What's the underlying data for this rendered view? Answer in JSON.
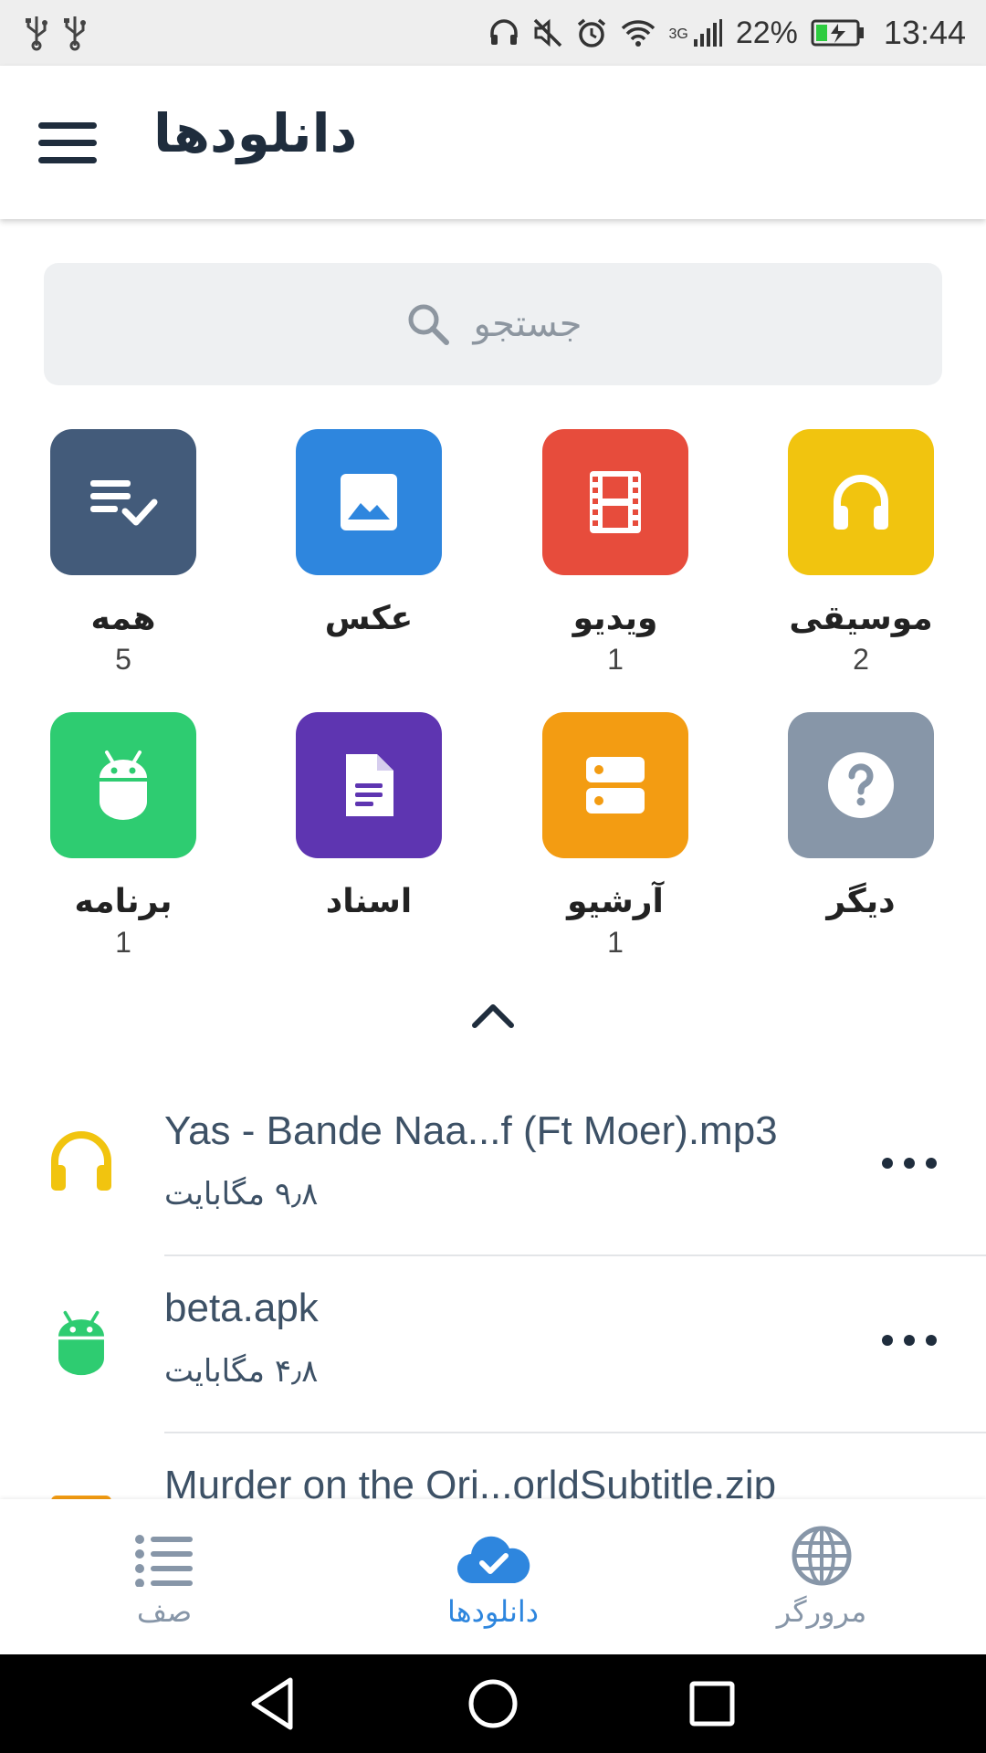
{
  "status_bar": {
    "battery_percent": "22%",
    "network": "3G",
    "time": "13:44"
  },
  "app_bar": {
    "title": "دانلودها"
  },
  "search": {
    "placeholder": "جستجو"
  },
  "categories": [
    {
      "label": "موسیقی",
      "count": "2",
      "color": "#f1c40f",
      "icon": "headphones-icon"
    },
    {
      "label": "ویدیو",
      "count": "1",
      "color": "#e74c3c",
      "icon": "film-icon"
    },
    {
      "label": "عکس",
      "count": "",
      "color": "#2e86de",
      "icon": "image-icon"
    },
    {
      "label": "همه",
      "count": "5",
      "color": "#435b7a",
      "icon": "list-check-icon"
    },
    {
      "label": "دیگر",
      "count": "",
      "color": "#8796a8",
      "icon": "question-icon"
    },
    {
      "label": "آرشیو",
      "count": "1",
      "color": "#f39c12",
      "icon": "archive-icon"
    },
    {
      "label": "اسناد",
      "count": "",
      "color": "#5e35b1",
      "icon": "document-icon"
    },
    {
      "label": "برنامه",
      "count": "1",
      "color": "#2ecc71",
      "icon": "android-icon"
    }
  ],
  "downloads": [
    {
      "name": "Yas - Bande Naa...f (Ft Moer).mp3",
      "size": "۹٫۸ مگابایت",
      "icon": "headphones-icon",
      "color": "#f1c40f"
    },
    {
      "name": "beta.apk",
      "size": "۴٫۸ مگابایت",
      "icon": "android-icon",
      "color": "#2ecc71"
    },
    {
      "name": "Murder on the Ori...orldSubtitle.zip",
      "size": "",
      "icon": "archive-icon",
      "color": "#f39c12"
    }
  ],
  "bottom_nav": {
    "browser": "مرورگر",
    "downloads": "دانلودها",
    "queue": "صف",
    "active_color": "#2e86de",
    "inactive_color": "#8796a8"
  }
}
